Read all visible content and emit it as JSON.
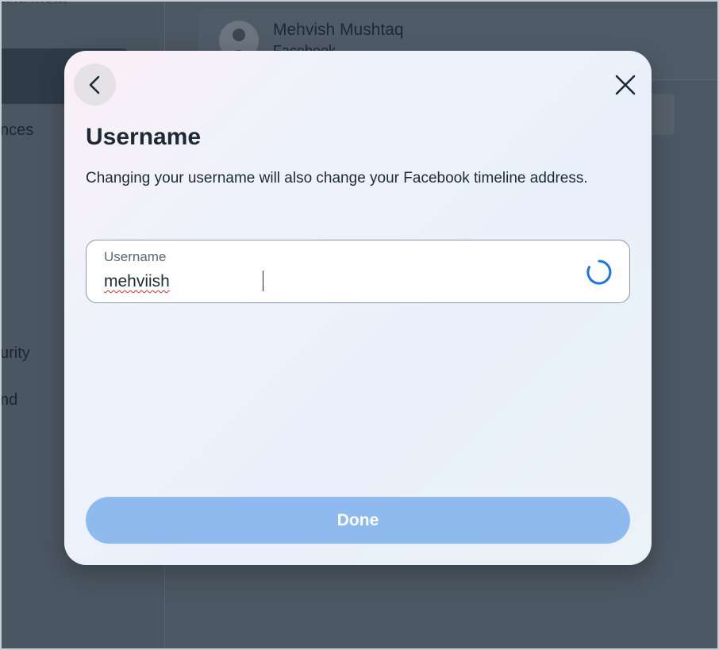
{
  "background": {
    "sidebar_items": [
      "and Meta",
      "nces",
      "urity",
      "nd"
    ],
    "profile_name": "Mehvish Mushtaq",
    "profile_sub": "Facebook"
  },
  "modal": {
    "title": "Username",
    "description": "Changing your username will also change your Facebook timeline address.",
    "field": {
      "label": "Username",
      "value": "mehviish"
    },
    "done_label": "Done"
  },
  "icons": {
    "back": "chevron-left-icon",
    "close": "close-icon",
    "loading": "spinner-icon"
  },
  "colors": {
    "done_button": "#8fbaef",
    "spinner": "#1a73e8"
  }
}
